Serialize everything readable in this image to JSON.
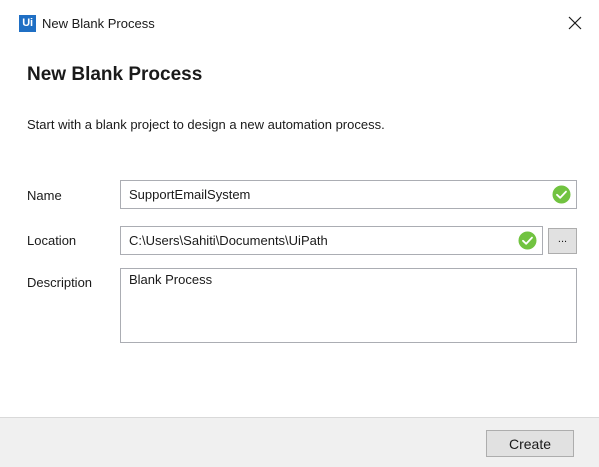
{
  "window": {
    "logo_text": "Ui",
    "title": "New Blank Process",
    "close_icon": "close-icon"
  },
  "heading": "New Blank Process",
  "description": "Start with a blank project to design a new automation process.",
  "form": {
    "name": {
      "label": "Name",
      "value": "SupportEmailSystem",
      "valid": true
    },
    "location": {
      "label": "Location",
      "value": "C:\\Users\\Sahiti\\Documents\\UiPath",
      "valid": true,
      "browse_label": "..."
    },
    "description": {
      "label": "Description",
      "value": "Blank Process"
    }
  },
  "footer": {
    "create_label": "Create"
  },
  "colors": {
    "logo_blue": "#1f6fc4",
    "valid_green": "#71c340",
    "footer_bg": "#f0f0f0",
    "button_bg": "#e1e1e1"
  }
}
